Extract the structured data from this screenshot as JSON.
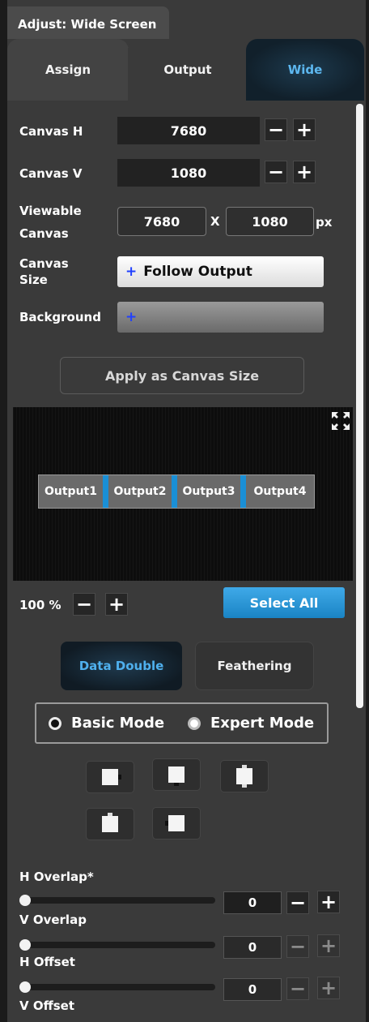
{
  "header": {
    "title": "Adjust: Wide Screen"
  },
  "tabs": [
    {
      "label": "Assign",
      "active": false
    },
    {
      "label": "Output",
      "active": false
    },
    {
      "label": "Wide",
      "active": true
    }
  ],
  "canvas": {
    "h_label": "Canvas H",
    "h_value": "7680",
    "v_label": "Canvas V",
    "v_value": "1080",
    "viewable_label": "Viewable Canvas",
    "viewable_w": "7680",
    "viewable_x": "X",
    "viewable_h": "1080",
    "viewable_unit": "px",
    "size_label": "Canvas Size",
    "size_button": "Follow Output",
    "background_label": "Background",
    "plus_symbol": "+",
    "minus_symbol": "−",
    "apply_button": "Apply as Canvas Size"
  },
  "preview": {
    "outputs": [
      "Output1",
      "Output2",
      "Output3",
      "Output4"
    ],
    "zoom": "100 %",
    "select_all": "Select All"
  },
  "mode_tabs": [
    {
      "label": "Data Double",
      "active": true
    },
    {
      "label": "Feathering",
      "active": false
    }
  ],
  "modes": {
    "basic": "Basic Mode",
    "expert": "Expert Mode",
    "selected": "Basic Mode"
  },
  "overlap": {
    "h_overlap_label": "H Overlap*",
    "h_overlap_value": "0",
    "v_overlap_label": "V Overlap",
    "v_overlap_value": "0",
    "h_offset_label": "H Offset",
    "h_offset_value": "0",
    "v_offset_label": "V Offset"
  },
  "colors": {
    "accent_blue": "#1a8fd6",
    "panel_bg": "#3a3a3a",
    "active_tab_text": "#5db8f0"
  }
}
